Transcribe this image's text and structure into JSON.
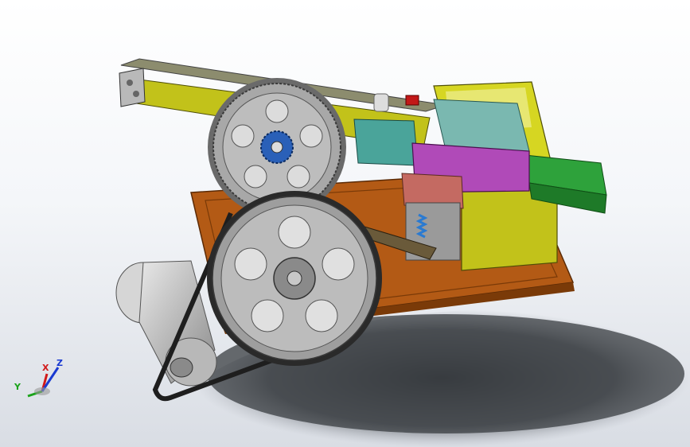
{
  "viewport": {
    "background_top": "#ffffff",
    "background_bottom": "#d9dde4"
  },
  "model": {
    "components": [
      "base-plate",
      "feed-rail",
      "large-gear",
      "motor-drum",
      "drive-pulley",
      "v-belt",
      "electric-motor",
      "slide-block",
      "guard-housing",
      "output-guide-rails",
      "connecting-rod",
      "spring"
    ],
    "colors": {
      "base_plate": "#b35a15",
      "rail_yellow": "#c2c21a",
      "gear_grey": "#a8a8a8",
      "motor_drum": "#c31ab4",
      "pinion": "#2a60b8",
      "slide_block": "#b04ab8",
      "teal_block": "#4aa49a",
      "guide_green": "#2ea23b",
      "motor_body": "#c9c9c9",
      "belt": "#1e1e1e",
      "red_part": "#c21818"
    }
  },
  "triad": {
    "x_label": "X",
    "y_label": "Y",
    "z_label": "Z",
    "x_color": "#d11a1a",
    "y_color": "#1aa31a",
    "z_color": "#1a3ad1"
  }
}
